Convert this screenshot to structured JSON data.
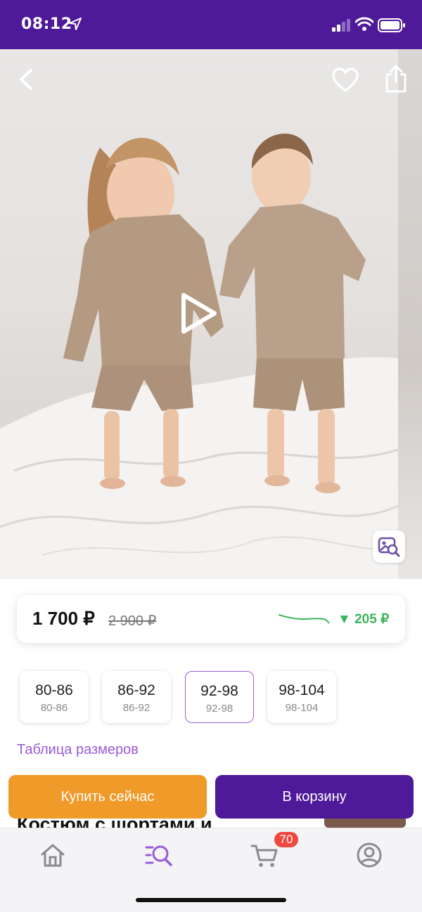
{
  "status_bar": {
    "time": "08:12"
  },
  "product": {
    "price_now": "1 700 ₽",
    "price_old": "2 900 ₽",
    "price_drop": "▼ 205 ₽",
    "title_peek": "Костюм с шортами и"
  },
  "sizes": {
    "items": [
      {
        "main": "80-86",
        "sub": "80-86",
        "selected": false
      },
      {
        "main": "86-92",
        "sub": "86-92",
        "selected": false
      },
      {
        "main": "92-98",
        "sub": "92-98",
        "selected": true
      },
      {
        "main": "98-104",
        "sub": "98-104",
        "selected": false
      }
    ],
    "table_link": "Таблица размеров"
  },
  "actions": {
    "buy_now": "Купить сейчас",
    "add_to_cart": "В корзину"
  },
  "tab_bar": {
    "items": [
      {
        "icon": "home-icon"
      },
      {
        "icon": "catalog-search-icon",
        "active": true
      },
      {
        "icon": "cart-icon"
      },
      {
        "icon": "profile-icon"
      }
    ],
    "cart_badge": "70"
  },
  "colors": {
    "brand": "#4f1a9a",
    "accent": "#9a5ad8",
    "buy": "#f09a2a",
    "drop": "#3bb55b",
    "badge": "#f0483e"
  }
}
